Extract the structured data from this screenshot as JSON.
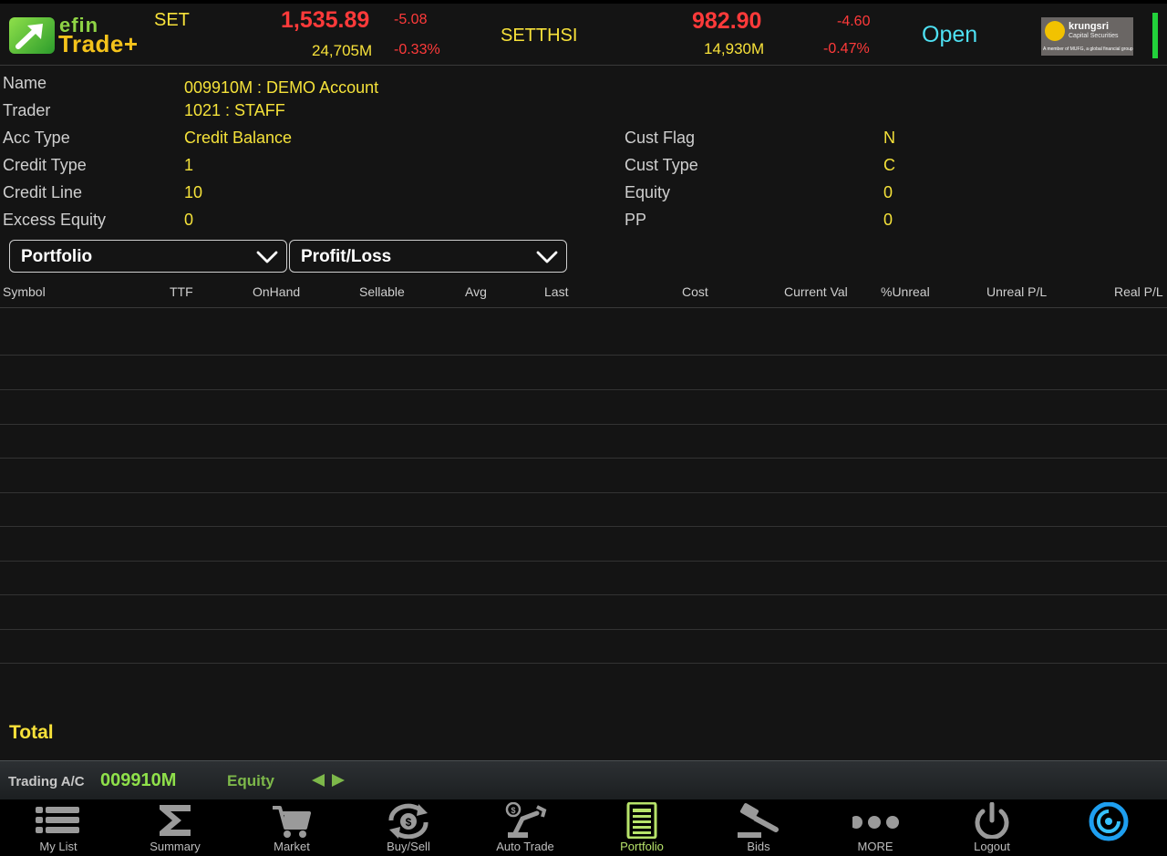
{
  "app": {
    "logo_top": "efin",
    "logo_bottom": "Trade+"
  },
  "indices": {
    "set": {
      "name": "SET",
      "value": "1,535.89",
      "change": "-5.08",
      "volume": "24,705M",
      "percent": "-0.33%"
    },
    "setthsi": {
      "name": "SETTHSI",
      "value": "982.90",
      "change": "-4.60",
      "volume": "14,930M",
      "percent": "-0.47%"
    }
  },
  "market_status": "Open",
  "broker": {
    "name": "krungsri",
    "sub": "Capital Securities",
    "foot": "A member of MUFG, a global financial group"
  },
  "account": {
    "name_label": "Name",
    "name_value": "009910M : DEMO Account",
    "trader_label": "Trader",
    "trader_value": "1021 : STAFF",
    "acc_type_label": "Acc Type",
    "acc_type_value": "Credit Balance",
    "credit_type_label": "Credit Type",
    "credit_type_value": "1",
    "credit_line_label": "Credit Line",
    "credit_line_value": "10",
    "excess_equity_label": "Excess Equity",
    "excess_equity_value": "0",
    "cust_flag_label": "Cust Flag",
    "cust_flag_value": "N",
    "cust_type_label": "Cust Type",
    "cust_type_value": "C",
    "equity_label": "Equity",
    "equity_value": "0",
    "pp_label": "PP",
    "pp_value": "0"
  },
  "dropdowns": {
    "view": "Portfolio",
    "mode": "Profit/Loss"
  },
  "table": {
    "columns": [
      "Symbol",
      "TTF",
      "OnHand",
      "Sellable",
      "Avg",
      "Last",
      "Cost",
      "Current Val",
      "%Unreal",
      "Unreal P/L",
      "Real P/L"
    ],
    "rows": []
  },
  "total_label": "Total",
  "trading_ac": {
    "label": "Trading A/C",
    "account": "009910M",
    "type": "Equity"
  },
  "nav": [
    {
      "label": "My List",
      "icon": "list-icon"
    },
    {
      "label": "Summary",
      "icon": "sigma-icon"
    },
    {
      "label": "Market",
      "icon": "cart-icon"
    },
    {
      "label": "Buy/Sell",
      "icon": "exchange-icon"
    },
    {
      "label": "Auto Trade",
      "icon": "robot-arm-icon"
    },
    {
      "label": "Portfolio",
      "icon": "portfolio-icon"
    },
    {
      "label": "Bids",
      "icon": "gavel-icon"
    },
    {
      "label": "MORE",
      "icon": "more-icon"
    },
    {
      "label": "Logout",
      "icon": "power-icon"
    },
    {
      "label": "",
      "icon": "sync-icon"
    }
  ],
  "colors": {
    "accent_yellow": "#f7e13a",
    "negative": "#ff3a3a",
    "status": "#4ee0f2",
    "active_nav": "#b7e36a",
    "connection": "#22d13b"
  }
}
